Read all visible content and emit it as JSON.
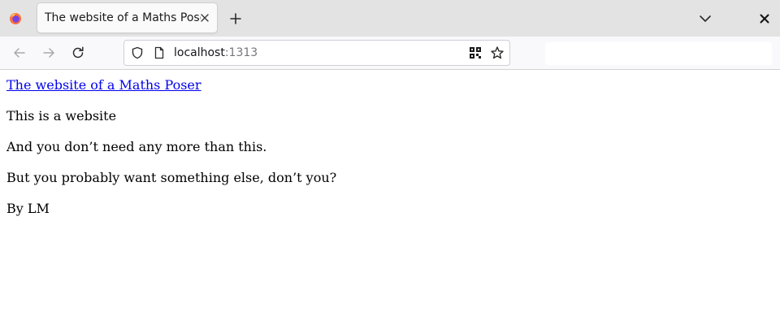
{
  "browser": {
    "tab": {
      "title": "The website of a Maths Poser"
    },
    "urlbar": {
      "host": "localhost",
      "port": ":1313"
    }
  },
  "page": {
    "link_text": "The website of a Maths Poser",
    "paragraphs": [
      "This is a website",
      "And you don’t need any more than this.",
      "But you probably want something else, don’t you?",
      "By LM"
    ]
  },
  "colors": {
    "tabstrip": "#e3e3e3",
    "toolbar": "#f9f9fb",
    "link": "#0000ee"
  }
}
